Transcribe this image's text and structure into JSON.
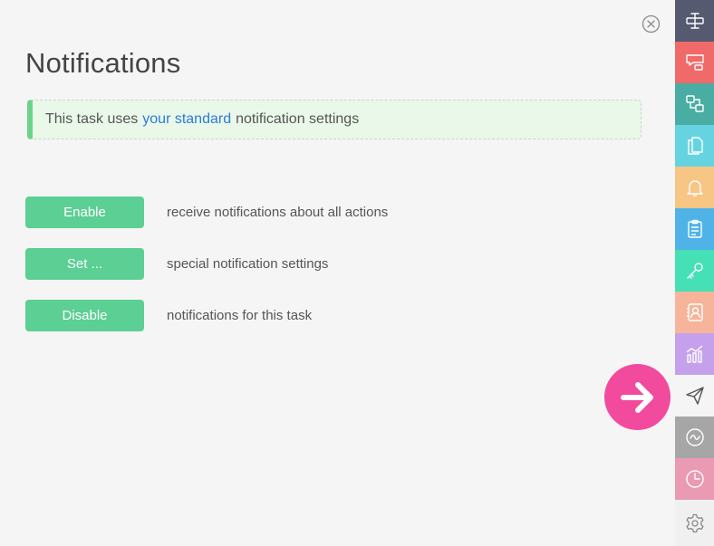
{
  "page": {
    "title": "Notifications",
    "close_icon": "close-circle-icon"
  },
  "banner": {
    "prefix": "This task uses",
    "link": "your standard",
    "suffix": "notification settings",
    "accent_color": "#6bd48a",
    "link_color": "#2b7bd8"
  },
  "options": [
    {
      "button": "Enable",
      "description": "receive notifications about all actions"
    },
    {
      "button": "Set ...",
      "description": "special notification settings"
    },
    {
      "button": "Disable",
      "description": "notifications for this task"
    }
  ],
  "button_color": "#5ccf94",
  "fab": {
    "icon": "arrow-right-icon",
    "color": "#f24a9c"
  },
  "sidebar": [
    {
      "icon": "text-cursor-icon",
      "color": "#565a70"
    },
    {
      "icon": "comment-icon",
      "color": "#f06a6a"
    },
    {
      "icon": "hierarchy-icon",
      "color": "#4aada3"
    },
    {
      "icon": "documents-icon",
      "color": "#66d4e0"
    },
    {
      "icon": "bell-icon",
      "color": "#f7c584"
    },
    {
      "icon": "clipboard-icon",
      "color": "#4fb3e8"
    },
    {
      "icon": "key-icon",
      "color": "#45e0b6"
    },
    {
      "icon": "contact-icon",
      "color": "#f6b49b"
    },
    {
      "icon": "chart-icon",
      "color": "#c4a0ed"
    },
    {
      "icon": "paper-plane-icon",
      "color": "#f5f5f5"
    },
    {
      "icon": "wave-circle-icon",
      "color": "#a6a6a6"
    },
    {
      "icon": "clock-icon",
      "color": "#ea9ab2"
    },
    {
      "icon": "gear-icon",
      "color": "#f0f0f0"
    }
  ]
}
